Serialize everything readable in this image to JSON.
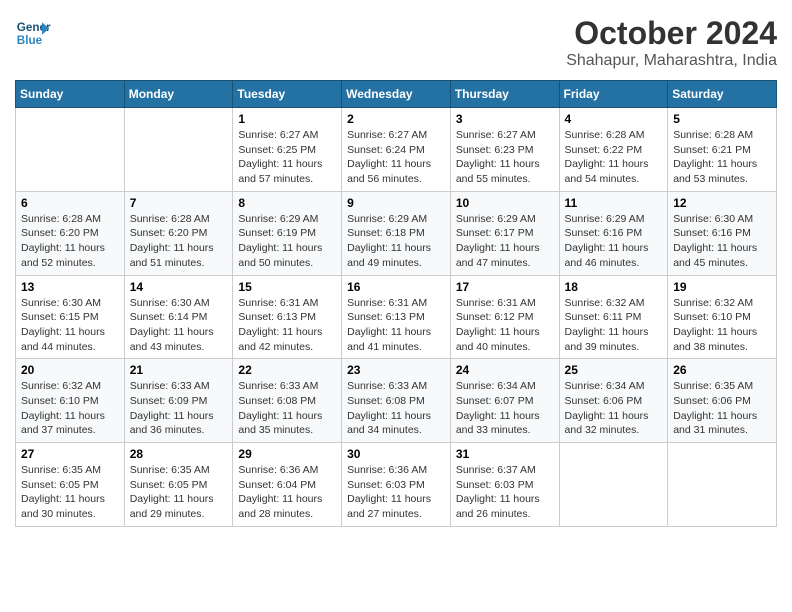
{
  "header": {
    "logo_line1": "General",
    "logo_line2": "Blue",
    "month": "October 2024",
    "location": "Shahapur, Maharashtra, India"
  },
  "weekdays": [
    "Sunday",
    "Monday",
    "Tuesday",
    "Wednesday",
    "Thursday",
    "Friday",
    "Saturday"
  ],
  "weeks": [
    [
      {
        "day": "",
        "sunrise": "",
        "sunset": "",
        "daylight": ""
      },
      {
        "day": "",
        "sunrise": "",
        "sunset": "",
        "daylight": ""
      },
      {
        "day": "1",
        "sunrise": "Sunrise: 6:27 AM",
        "sunset": "Sunset: 6:25 PM",
        "daylight": "Daylight: 11 hours and 57 minutes."
      },
      {
        "day": "2",
        "sunrise": "Sunrise: 6:27 AM",
        "sunset": "Sunset: 6:24 PM",
        "daylight": "Daylight: 11 hours and 56 minutes."
      },
      {
        "day": "3",
        "sunrise": "Sunrise: 6:27 AM",
        "sunset": "Sunset: 6:23 PM",
        "daylight": "Daylight: 11 hours and 55 minutes."
      },
      {
        "day": "4",
        "sunrise": "Sunrise: 6:28 AM",
        "sunset": "Sunset: 6:22 PM",
        "daylight": "Daylight: 11 hours and 54 minutes."
      },
      {
        "day": "5",
        "sunrise": "Sunrise: 6:28 AM",
        "sunset": "Sunset: 6:21 PM",
        "daylight": "Daylight: 11 hours and 53 minutes."
      }
    ],
    [
      {
        "day": "6",
        "sunrise": "Sunrise: 6:28 AM",
        "sunset": "Sunset: 6:20 PM",
        "daylight": "Daylight: 11 hours and 52 minutes."
      },
      {
        "day": "7",
        "sunrise": "Sunrise: 6:28 AM",
        "sunset": "Sunset: 6:20 PM",
        "daylight": "Daylight: 11 hours and 51 minutes."
      },
      {
        "day": "8",
        "sunrise": "Sunrise: 6:29 AM",
        "sunset": "Sunset: 6:19 PM",
        "daylight": "Daylight: 11 hours and 50 minutes."
      },
      {
        "day": "9",
        "sunrise": "Sunrise: 6:29 AM",
        "sunset": "Sunset: 6:18 PM",
        "daylight": "Daylight: 11 hours and 49 minutes."
      },
      {
        "day": "10",
        "sunrise": "Sunrise: 6:29 AM",
        "sunset": "Sunset: 6:17 PM",
        "daylight": "Daylight: 11 hours and 47 minutes."
      },
      {
        "day": "11",
        "sunrise": "Sunrise: 6:29 AM",
        "sunset": "Sunset: 6:16 PM",
        "daylight": "Daylight: 11 hours and 46 minutes."
      },
      {
        "day": "12",
        "sunrise": "Sunrise: 6:30 AM",
        "sunset": "Sunset: 6:16 PM",
        "daylight": "Daylight: 11 hours and 45 minutes."
      }
    ],
    [
      {
        "day": "13",
        "sunrise": "Sunrise: 6:30 AM",
        "sunset": "Sunset: 6:15 PM",
        "daylight": "Daylight: 11 hours and 44 minutes."
      },
      {
        "day": "14",
        "sunrise": "Sunrise: 6:30 AM",
        "sunset": "Sunset: 6:14 PM",
        "daylight": "Daylight: 11 hours and 43 minutes."
      },
      {
        "day": "15",
        "sunrise": "Sunrise: 6:31 AM",
        "sunset": "Sunset: 6:13 PM",
        "daylight": "Daylight: 11 hours and 42 minutes."
      },
      {
        "day": "16",
        "sunrise": "Sunrise: 6:31 AM",
        "sunset": "Sunset: 6:13 PM",
        "daylight": "Daylight: 11 hours and 41 minutes."
      },
      {
        "day": "17",
        "sunrise": "Sunrise: 6:31 AM",
        "sunset": "Sunset: 6:12 PM",
        "daylight": "Daylight: 11 hours and 40 minutes."
      },
      {
        "day": "18",
        "sunrise": "Sunrise: 6:32 AM",
        "sunset": "Sunset: 6:11 PM",
        "daylight": "Daylight: 11 hours and 39 minutes."
      },
      {
        "day": "19",
        "sunrise": "Sunrise: 6:32 AM",
        "sunset": "Sunset: 6:10 PM",
        "daylight": "Daylight: 11 hours and 38 minutes."
      }
    ],
    [
      {
        "day": "20",
        "sunrise": "Sunrise: 6:32 AM",
        "sunset": "Sunset: 6:10 PM",
        "daylight": "Daylight: 11 hours and 37 minutes."
      },
      {
        "day": "21",
        "sunrise": "Sunrise: 6:33 AM",
        "sunset": "Sunset: 6:09 PM",
        "daylight": "Daylight: 11 hours and 36 minutes."
      },
      {
        "day": "22",
        "sunrise": "Sunrise: 6:33 AM",
        "sunset": "Sunset: 6:08 PM",
        "daylight": "Daylight: 11 hours and 35 minutes."
      },
      {
        "day": "23",
        "sunrise": "Sunrise: 6:33 AM",
        "sunset": "Sunset: 6:08 PM",
        "daylight": "Daylight: 11 hours and 34 minutes."
      },
      {
        "day": "24",
        "sunrise": "Sunrise: 6:34 AM",
        "sunset": "Sunset: 6:07 PM",
        "daylight": "Daylight: 11 hours and 33 minutes."
      },
      {
        "day": "25",
        "sunrise": "Sunrise: 6:34 AM",
        "sunset": "Sunset: 6:06 PM",
        "daylight": "Daylight: 11 hours and 32 minutes."
      },
      {
        "day": "26",
        "sunrise": "Sunrise: 6:35 AM",
        "sunset": "Sunset: 6:06 PM",
        "daylight": "Daylight: 11 hours and 31 minutes."
      }
    ],
    [
      {
        "day": "27",
        "sunrise": "Sunrise: 6:35 AM",
        "sunset": "Sunset: 6:05 PM",
        "daylight": "Daylight: 11 hours and 30 minutes."
      },
      {
        "day": "28",
        "sunrise": "Sunrise: 6:35 AM",
        "sunset": "Sunset: 6:05 PM",
        "daylight": "Daylight: 11 hours and 29 minutes."
      },
      {
        "day": "29",
        "sunrise": "Sunrise: 6:36 AM",
        "sunset": "Sunset: 6:04 PM",
        "daylight": "Daylight: 11 hours and 28 minutes."
      },
      {
        "day": "30",
        "sunrise": "Sunrise: 6:36 AM",
        "sunset": "Sunset: 6:03 PM",
        "daylight": "Daylight: 11 hours and 27 minutes."
      },
      {
        "day": "31",
        "sunrise": "Sunrise: 6:37 AM",
        "sunset": "Sunset: 6:03 PM",
        "daylight": "Daylight: 11 hours and 26 minutes."
      },
      {
        "day": "",
        "sunrise": "",
        "sunset": "",
        "daylight": ""
      },
      {
        "day": "",
        "sunrise": "",
        "sunset": "",
        "daylight": ""
      }
    ]
  ]
}
